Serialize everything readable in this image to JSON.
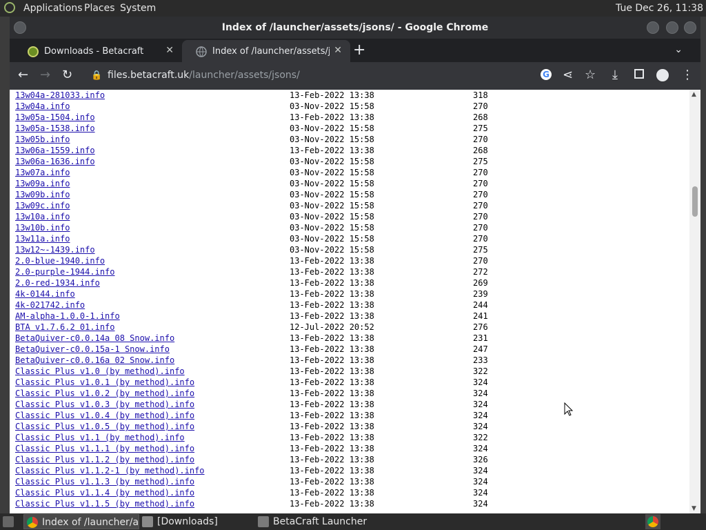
{
  "top_panel": {
    "menus": [
      "Applications",
      "Places",
      "System"
    ],
    "clock": "Tue Dec 26, 11:38"
  },
  "window": {
    "title": "Index of /launcher/assets/jsons/ - Google Chrome"
  },
  "tabs": [
    {
      "title": "Downloads - Betacraft",
      "close": "✕",
      "active": false
    },
    {
      "title": "Index of /launcher/assets/jsons/",
      "close": "✕",
      "active": true
    }
  ],
  "toolbar": {
    "url_host": "files.betacraft.uk",
    "url_path": "/launcher/assets/jsons/"
  },
  "listing": [
    {
      "name": "13w04a-281033.info",
      "date": "13-Feb-2022 13:38",
      "size": "318"
    },
    {
      "name": "13w04a.info",
      "date": "03-Nov-2022 15:58",
      "size": "270"
    },
    {
      "name": "13w05a-1504.info",
      "date": "13-Feb-2022 13:38",
      "size": "268"
    },
    {
      "name": "13w05a-1538.info",
      "date": "03-Nov-2022 15:58",
      "size": "275"
    },
    {
      "name": "13w05b.info",
      "date": "03-Nov-2022 15:58",
      "size": "270"
    },
    {
      "name": "13w06a-1559.info",
      "date": "13-Feb-2022 13:38",
      "size": "268"
    },
    {
      "name": "13w06a-1636.info",
      "date": "03-Nov-2022 15:58",
      "size": "275"
    },
    {
      "name": "13w07a.info",
      "date": "03-Nov-2022 15:58",
      "size": "270"
    },
    {
      "name": "13w09a.info",
      "date": "03-Nov-2022 15:58",
      "size": "270"
    },
    {
      "name": "13w09b.info",
      "date": "03-Nov-2022 15:58",
      "size": "270"
    },
    {
      "name": "13w09c.info",
      "date": "03-Nov-2022 15:58",
      "size": "270"
    },
    {
      "name": "13w10a.info",
      "date": "03-Nov-2022 15:58",
      "size": "270"
    },
    {
      "name": "13w10b.info",
      "date": "03-Nov-2022 15:58",
      "size": "270"
    },
    {
      "name": "13w11a.info",
      "date": "03-Nov-2022 15:58",
      "size": "270"
    },
    {
      "name": "13w12~-1439.info",
      "date": "03-Nov-2022 15:58",
      "size": "275"
    },
    {
      "name": "2.0-blue-1940.info",
      "date": "13-Feb-2022 13:38",
      "size": "270"
    },
    {
      "name": "2.0-purple-1944.info",
      "date": "13-Feb-2022 13:38",
      "size": "272"
    },
    {
      "name": "2.0-red-1934.info",
      "date": "13-Feb-2022 13:38",
      "size": "269"
    },
    {
      "name": "4k-0144.info",
      "date": "13-Feb-2022 13:38",
      "size": "239"
    },
    {
      "name": "4k-021742.info",
      "date": "13-Feb-2022 13:38",
      "size": "244"
    },
    {
      "name": "AM-alpha-1.0.0-1.info",
      "date": "13-Feb-2022 13:38",
      "size": "241"
    },
    {
      "name": "BTA v1.7.6.2 01.info",
      "date": "12-Jul-2022 20:52",
      "size": "276"
    },
    {
      "name": "BetaQuiver-c0.0.14a 08 Snow.info",
      "date": "13-Feb-2022 13:38",
      "size": "231"
    },
    {
      "name": "BetaQuiver-c0.0.15a-1 Snow.info",
      "date": "13-Feb-2022 13:38",
      "size": "247"
    },
    {
      "name": "BetaQuiver-c0.0.16a 02 Snow.info",
      "date": "13-Feb-2022 13:38",
      "size": "233"
    },
    {
      "name": "Classic Plus v1.0 (by method).info",
      "date": "13-Feb-2022 13:38",
      "size": "322"
    },
    {
      "name": "Classic Plus v1.0.1 (by method).info",
      "date": "13-Feb-2022 13:38",
      "size": "324"
    },
    {
      "name": "Classic Plus v1.0.2 (by method).info",
      "date": "13-Feb-2022 13:38",
      "size": "324"
    },
    {
      "name": "Classic Plus v1.0.3 (by method).info",
      "date": "13-Feb-2022 13:38",
      "size": "324"
    },
    {
      "name": "Classic Plus v1.0.4 (by method).info",
      "date": "13-Feb-2022 13:38",
      "size": "324"
    },
    {
      "name": "Classic Plus v1.0.5 (by method).info",
      "date": "13-Feb-2022 13:38",
      "size": "324"
    },
    {
      "name": "Classic Plus v1.1 (by method).info",
      "date": "13-Feb-2022 13:38",
      "size": "322"
    },
    {
      "name": "Classic Plus v1.1.1 (by method).info",
      "date": "13-Feb-2022 13:38",
      "size": "324"
    },
    {
      "name": "Classic Plus v1.1.2 (by method).info",
      "date": "13-Feb-2022 13:38",
      "size": "326"
    },
    {
      "name": "Classic Plus v1.1.2-1 (by method).info",
      "date": "13-Feb-2022 13:38",
      "size": "324"
    },
    {
      "name": "Classic Plus v1.1.3 (by method).info",
      "date": "13-Feb-2022 13:38",
      "size": "324"
    },
    {
      "name": "Classic Plus v1.1.4 (by method).info",
      "date": "13-Feb-2022 13:38",
      "size": "324"
    },
    {
      "name": "Classic Plus v1.1.5 (by method).info",
      "date": "13-Feb-2022 13:38",
      "size": "324"
    }
  ],
  "taskbar": {
    "items": [
      {
        "label": "Index of /launcher/a...",
        "icon": "chrome-icon",
        "active": true
      },
      {
        "label": "[Downloads]",
        "icon": "folder-icon",
        "active": false
      },
      {
        "label": "BetaCraft Launcher ...",
        "icon": "java-icon",
        "active": false
      }
    ]
  },
  "colors": {
    "link": "#1a0dab",
    "chrome_dark": "#35363a",
    "panel": "#2b2b2b"
  }
}
